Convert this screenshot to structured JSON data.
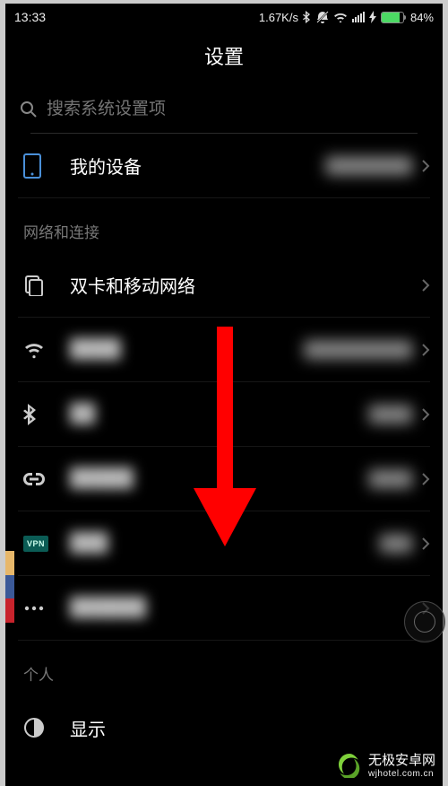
{
  "status": {
    "time": "13:33",
    "net_speed": "1.67K/s",
    "battery_pct": "84%"
  },
  "header": {
    "title": "设置"
  },
  "search": {
    "placeholder": "搜索系统设置项"
  },
  "sections": {
    "device": {
      "label": "我的设备",
      "value": "████████"
    },
    "network_title": "网络和连接",
    "sim": {
      "label": "双卡和移动网络"
    },
    "wifi": {
      "label": "████",
      "value": "██████████"
    },
    "bt": {
      "label": "██",
      "value": "████"
    },
    "hotspot": {
      "label": "█████",
      "value": "████"
    },
    "vpn": {
      "badge": "VPN",
      "label": "███",
      "value": "███"
    },
    "more": {
      "label": "██████"
    },
    "personal_title": "个人",
    "display": {
      "label": "显示"
    }
  },
  "watermark": {
    "line1": "无极安卓网",
    "line2": "wjhotel.com.cn"
  }
}
